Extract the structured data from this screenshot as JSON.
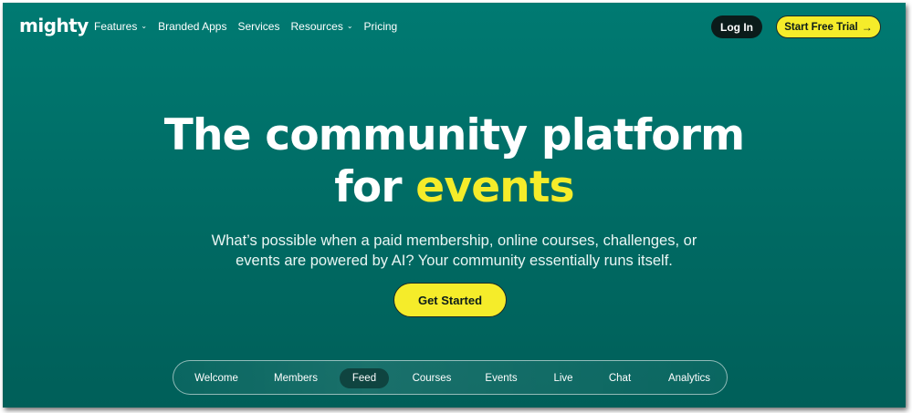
{
  "nav": {
    "logo": "mighty",
    "links": [
      {
        "label": "Features",
        "dropdown": true
      },
      {
        "label": "Branded Apps",
        "dropdown": false
      },
      {
        "label": "Services",
        "dropdown": false
      },
      {
        "label": "Resources",
        "dropdown": true
      },
      {
        "label": "Pricing",
        "dropdown": false
      }
    ],
    "chevron": "⌄",
    "login_label": "Log In",
    "trial_label": "Start Free Trial",
    "trial_arrow": "→"
  },
  "hero": {
    "title_line1": "The community platform",
    "title_for": "for ",
    "title_highlight": "events",
    "subtitle_line1": "What’s possible when a paid membership, online courses, challenges, or",
    "subtitle_line2": "events are powered by AI? Your community essentially runs itself.",
    "cta_label": "Get Started"
  },
  "tabs": {
    "items": [
      "Welcome",
      "Members",
      "Feed",
      "Courses",
      "Events",
      "Live",
      "Chat",
      "Analytics"
    ],
    "active": "Feed"
  },
  "colors": {
    "background": "#00726a",
    "accent": "#f5ec2a",
    "dark": "#0b1b1a",
    "active_tab": "#0f4440"
  }
}
